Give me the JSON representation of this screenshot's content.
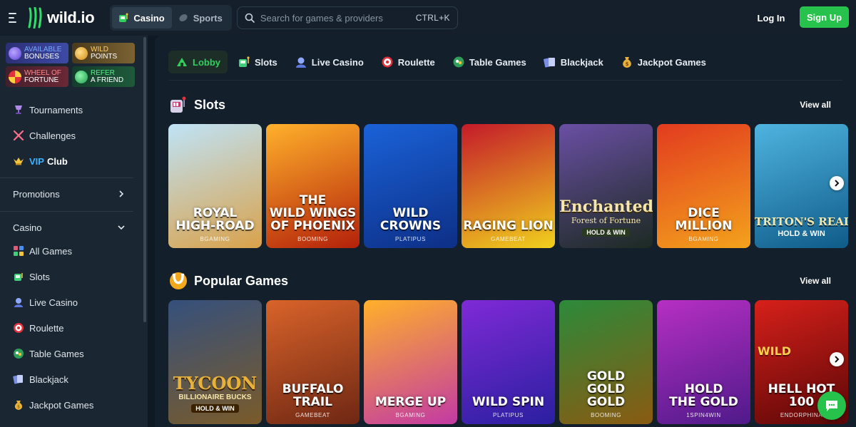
{
  "header": {
    "logo_text": "wild.io",
    "modes": [
      {
        "label": "Casino",
        "icon": "slot-machine-icon",
        "active": true
      },
      {
        "label": "Sports",
        "icon": "ball-icon",
        "active": false
      }
    ],
    "search": {
      "placeholder": "Search for games & providers",
      "shortcut": "CTRL+K",
      "value": ""
    },
    "login_label": "Log In",
    "signup_label": "Sign Up",
    "colors": {
      "accent": "#27c24c",
      "bg": "#0f1923",
      "panel": "#1a2632"
    }
  },
  "sidebar": {
    "promos": [
      {
        "line1": "AVAILABLE",
        "line2": "BONUSES",
        "icon": "gift-icon"
      },
      {
        "line1": "WILD",
        "line2": "POINTS",
        "icon": "coin-icon"
      },
      {
        "line1": "WHEEL OF",
        "line2": "FORTUNE",
        "icon": "wheel-icon"
      },
      {
        "line1": "REFER",
        "line2": "A FRIEND",
        "icon": "megaphone-icon"
      }
    ],
    "links": [
      {
        "label": "Tournaments",
        "icon": "trophy-icon"
      },
      {
        "label": "Challenges",
        "icon": "swords-icon"
      }
    ],
    "vip": {
      "word": "VIP",
      "rest": "Club",
      "icon": "crown-icon"
    },
    "promotions_label": "Promotions",
    "casino_label": "Casino",
    "casino_items": [
      {
        "label": "All Games",
        "icon": "grid-icon"
      },
      {
        "label": "Slots",
        "icon": "slot-machine-icon"
      },
      {
        "label": "Live Casino",
        "icon": "dealer-icon"
      },
      {
        "label": "Roulette",
        "icon": "roulette-icon"
      },
      {
        "label": "Table Games",
        "icon": "table-icon"
      },
      {
        "label": "Blackjack",
        "icon": "cards-icon"
      },
      {
        "label": "Jackpot Games",
        "icon": "money-bag-icon"
      }
    ]
  },
  "tabs": [
    {
      "label": "Lobby",
      "icon": "lobby-icon",
      "active": true
    },
    {
      "label": "Slots",
      "icon": "slot-machine-icon",
      "active": false
    },
    {
      "label": "Live Casino",
      "icon": "dealer-icon",
      "active": false
    },
    {
      "label": "Roulette",
      "icon": "roulette-icon",
      "active": false
    },
    {
      "label": "Table Games",
      "icon": "table-icon",
      "active": false
    },
    {
      "label": "Blackjack",
      "icon": "cards-icon",
      "active": false
    },
    {
      "label": "Jackpot Games",
      "icon": "money-bag-icon",
      "active": false
    }
  ],
  "sections": [
    {
      "title": "Slots",
      "icon": "slot-machine-icon",
      "view_all": "View all",
      "games": [
        {
          "title_lines": [
            "ROYAL",
            "HIGH-ROAD"
          ],
          "provider": "BGAMING",
          "bg": [
            "#bfe3f7",
            "#d9a24b"
          ]
        },
        {
          "title_lines": [
            "THE",
            "WILD WINGS",
            "OF PHOENIX"
          ],
          "provider": "BOOMING",
          "bg": [
            "#ffb12b",
            "#b3210a"
          ]
        },
        {
          "title_lines": [
            "WILD",
            "CROWNS"
          ],
          "provider": "PLATIPUS",
          "bg": [
            "#1a62d8",
            "#0d2f86"
          ]
        },
        {
          "title_lines": [
            "RAGING LION"
          ],
          "provider": "GAMEBEAT",
          "bg": [
            "#c41a2a",
            "#f0d11d"
          ]
        },
        {
          "title_lines": [],
          "provider": "",
          "bg": [
            "#6a4fa4",
            "#1c2a22"
          ]
        },
        {
          "title_lines": [
            "DICE",
            "MILLION"
          ],
          "provider": "BGAMING",
          "bg": [
            "#e23b1f",
            "#f3a21c"
          ]
        },
        {
          "title_lines": [],
          "provider": "",
          "bg": [
            "#4fb4e0",
            "#0f5b88"
          ]
        }
      ]
    },
    {
      "title": "Popular Games",
      "icon": "horseshoe-icon",
      "view_all": "View all",
      "games": [
        {
          "title_lines": [],
          "provider": "",
          "bg": [
            "#35507c",
            "#7a5b2a"
          ]
        },
        {
          "title_lines": [
            "BUFFALO",
            "TRAIL"
          ],
          "provider": "GAMEBEAT",
          "bg": [
            "#d9632a",
            "#6e2713"
          ]
        },
        {
          "title_lines": [
            "MERGE UP"
          ],
          "provider": "BGAMING",
          "bg": [
            "#ffb02a",
            "#c23aa4"
          ]
        },
        {
          "title_lines": [
            "WILD SPIN"
          ],
          "provider": "PLATIPUS",
          "bg": [
            "#7f2ad6",
            "#2a1fa0"
          ]
        },
        {
          "title_lines": [
            "GOLD",
            "GOLD",
            "GOLD"
          ],
          "provider": "BOOMING",
          "bg": [
            "#2c8a3a",
            "#8a5a12"
          ]
        },
        {
          "title_lines": [
            "HOLD",
            "THE GOLD"
          ],
          "provider": "1SPIN4WIN",
          "bg": [
            "#b62fc3",
            "#4f1a8a"
          ]
        },
        {
          "title_lines": [
            "HELL HOT",
            "100"
          ],
          "provider": "ENDORPHINA",
          "bg": [
            "#d7201a",
            "#5a0707"
          ]
        }
      ]
    }
  ],
  "artwork_text": {
    "enchanted": [
      "Enchanted",
      "Forest of Fortune",
      "HOLD & WIN"
    ],
    "triton": [
      "TRITON'S REALM",
      "HOLD & WIN"
    ],
    "tycoon": [
      "TYCOON",
      "BILLIONAIRE BUCKS",
      "HOLD & WIN"
    ],
    "wild_badge": "WILD"
  }
}
